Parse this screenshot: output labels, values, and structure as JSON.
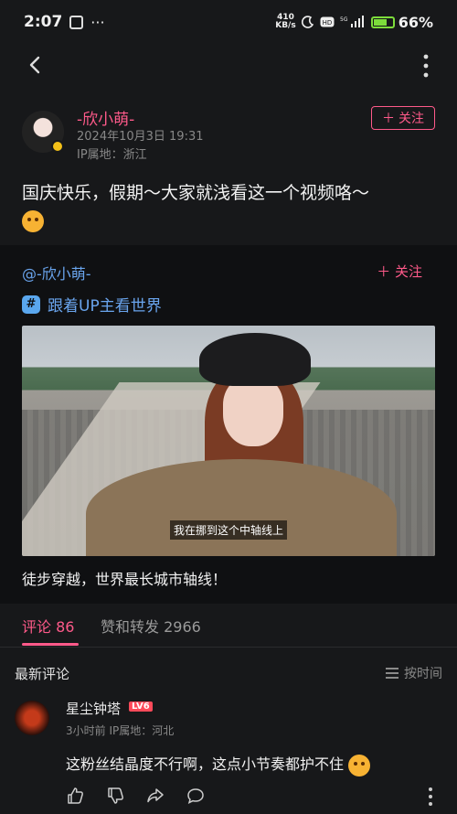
{
  "status_bar": {
    "time": "2:07",
    "speed_value": "410",
    "speed_unit": "KB/s",
    "battery": "66%"
  },
  "post": {
    "author_name": "-欣小萌-",
    "time": "2024年10月3日 19:31",
    "ip": "IP属地：浙江",
    "follow_label": "关注",
    "text": "国庆快乐，假期～大家就浅看这一个视频咯～"
  },
  "repost": {
    "user": "@-欣小萌-",
    "follow_label": "关注",
    "topic": "跟着UP主看世界",
    "subtitle": "我在挪到这个中轴线上",
    "caption": "徒步穿越，世界最长城市轴线！"
  },
  "tabs": {
    "comments": "评论 86",
    "likes": "赞和转发 2966"
  },
  "comments_header": {
    "title": "最新评论",
    "sort": "按时间"
  },
  "comment": {
    "name": "星尘钟塔",
    "level": "LV6",
    "meta": "3小时前  IP属地：河北",
    "text": "这粉丝结晶度不行啊，这点小节奏都护不住"
  },
  "colors": {
    "accent": "#ff5a8a",
    "link": "#6aa5ee",
    "background": "#17181a"
  }
}
